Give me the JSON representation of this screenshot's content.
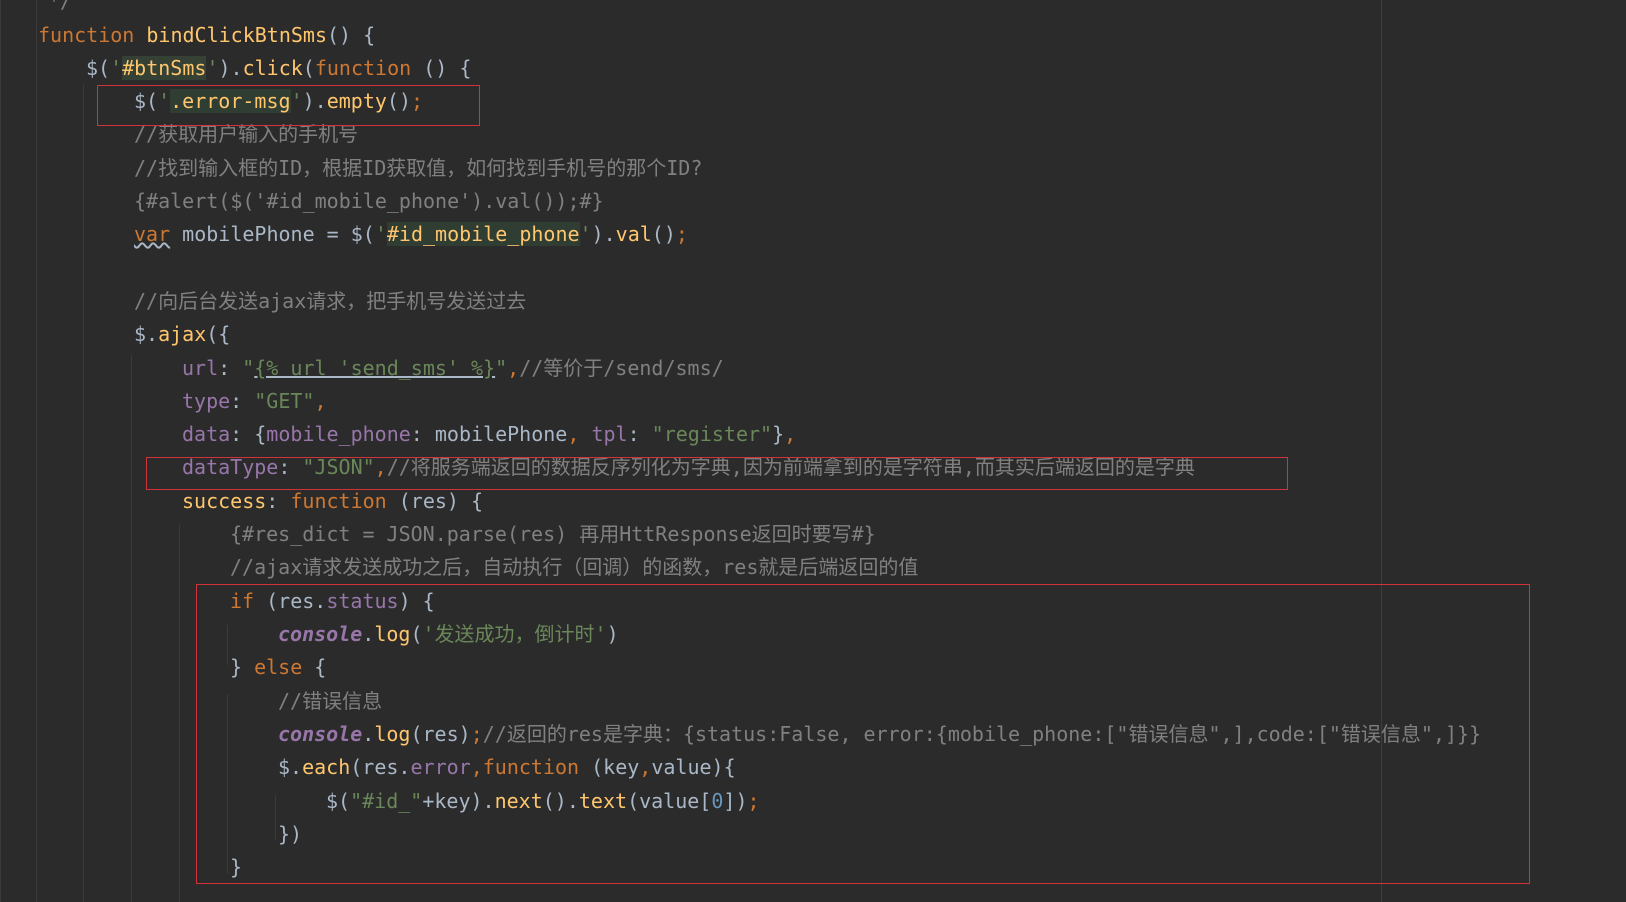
{
  "editor": {
    "lines": {
      "l0": "*/",
      "l1_kw": "function",
      "l1_name": "bindClickBtnSms",
      "l1_rest": "() {",
      "l2_a": "$(",
      "l2_q1": "'",
      "l2_sel": "#btnSms",
      "l2_q2": "'",
      "l2_b": ").",
      "l2_click": "click",
      "l2_c": "(",
      "l2_kw": "function",
      "l2_d": " () {",
      "l3_a": "$(",
      "l3_q1": "'",
      "l3_sel": ".error-msg",
      "l3_q2": "'",
      "l3_b": ").",
      "l3_empty": "empty",
      "l3_c": "()",
      "l3_semi": ";",
      "l4": "//获取用户输入的手机号",
      "l5": "//找到输入框的ID，根据ID获取值，如何找到手机号的那个ID?",
      "l6": "{#alert($('#id_mobile_phone').val());#}",
      "l7_var": "var",
      "l7_a": " mobilePhone = $(",
      "l7_q1": "'",
      "l7_sel": "#id_mobile_phone",
      "l7_q2": "'",
      "l7_b": ").",
      "l7_val": "val",
      "l7_c": "()",
      "l7_semi": ";",
      "l9": "//向后台发送ajax请求，把手机号发送过去",
      "l10_a": "$.",
      "l10_ajax": "ajax",
      "l10_b": "({",
      "l11_key": "url",
      "l11_colon": ": ",
      "l11_q1": "\"",
      "l11_tpl": "{% url 'send_sms' %}",
      "l11_q2": "\"",
      "l11_comma": ",",
      "l11_cmt": "//等价于/send/sms/",
      "l12_key": "type",
      "l12_colon": ": ",
      "l12_val": "\"GET\"",
      "l12_comma": ",",
      "l13_key": "data",
      "l13_a": ": {",
      "l13_k1": "mobile_phone",
      "l13_b": ": mobilePhone",
      "l13_comma1": ", ",
      "l13_k2": "tpl",
      "l13_c": ": ",
      "l13_val": "\"register\"",
      "l13_d": "}",
      "l13_comma2": ",",
      "l14_key": "dataType",
      "l14_colon": ": ",
      "l14_val": "\"JSON\"",
      "l14_comma": ",",
      "l14_cmt": "//将服务端返回的数据反序列化为字典,因为前端拿到的是字符串,而其实后端返回的是字典",
      "l15_key": "success",
      "l15_colon": ": ",
      "l15_kw": "function",
      "l15_rest": " (res) {",
      "l16": "{#res_dict = JSON.parse(res) 再用HttResponse返回时要写#}",
      "l17": "//ajax请求发送成功之后，自动执行（回调）的函数，res就是后端返回的值",
      "l18_kw": "if",
      "l18_a": " (res.",
      "l18_prop": "status",
      "l18_b": ") {",
      "l19_console": "console",
      "l19_a": ".",
      "l19_log": "log",
      "l19_b": "(",
      "l19_str": "'发送成功，倒计时'",
      "l19_c": ")",
      "l20_a": "} ",
      "l20_kw": "else",
      "l20_b": " {",
      "l21": "//错误信息",
      "l22_console": "console",
      "l22_a": ".",
      "l22_log": "log",
      "l22_b": "(res)",
      "l22_semi": ";",
      "l22_cmt": "//返回的res是字典：{status:False, error:{mobile_phone:[\"错误信息\",],code:[\"错误信息\",]}}",
      "l23_a": "$.",
      "l23_each": "each",
      "l23_b": "(res.",
      "l23_prop": "error",
      "l23_comma": ",",
      "l23_kw": "function",
      "l23_c": " (key",
      "l23_comma2": ",",
      "l23_d": "value){",
      "l24_a": "$(",
      "l24_str": "\"#id_\"",
      "l24_b": "+key).",
      "l24_next": "next",
      "l24_c": "().",
      "l24_text": "text",
      "l24_d": "(value[",
      "l24_num": "0",
      "l24_e": "])",
      "l24_semi": ";",
      "l25": "})",
      "l26": "}"
    }
  },
  "colors": {
    "background": "#2b2b2b",
    "keyword": "#cc7832",
    "function_name": "#ffc66d",
    "string": "#6a8759",
    "comment": "#808080",
    "property": "#9876aa",
    "number": "#6897bb",
    "default_text": "#a9b7c6",
    "annotation_box": "#d0343a"
  }
}
